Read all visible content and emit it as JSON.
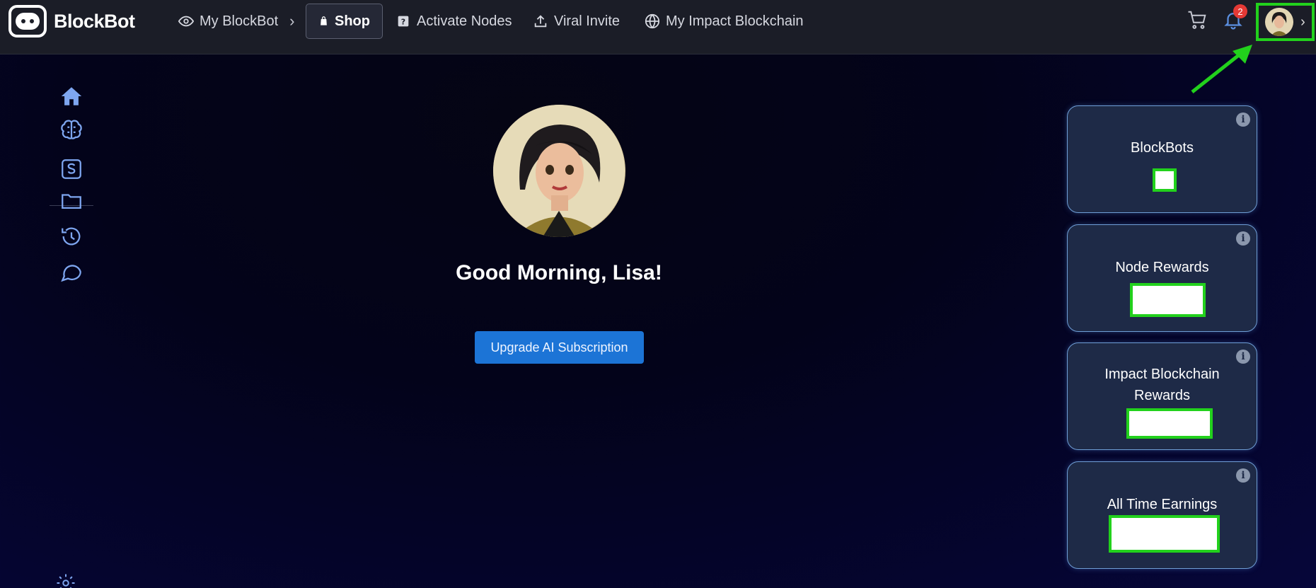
{
  "brand": {
    "name": "BlockBot"
  },
  "nav": {
    "my_blockbot": "My BlockBot",
    "shop": "Shop",
    "activate_nodes": "Activate Nodes",
    "viral_invite": "Viral Invite",
    "my_impact": "My Impact Blockchain"
  },
  "header": {
    "notifications_count": "2"
  },
  "main": {
    "greeting": "Good Morning, Lisa!",
    "upgrade_button": "Upgrade AI Subscription"
  },
  "cards": [
    {
      "title": "BlockBots"
    },
    {
      "title": "Node Rewards"
    },
    {
      "title_line1": "Impact Blockchain",
      "title_line2": "Rewards"
    },
    {
      "title": "All Time Earnings"
    }
  ],
  "colors": {
    "topbar": "#1b1d27",
    "accent_blue": "#1c74d6",
    "highlight_green": "#22d11c",
    "card_bg": "#1e2a47",
    "badge_red": "#e53935"
  },
  "icons": {
    "sidebar": [
      "home-icon",
      "brain-icon",
      "dollar-icon",
      "folder-icon",
      "history-icon",
      "chat-icon",
      "settings-icon"
    ]
  }
}
